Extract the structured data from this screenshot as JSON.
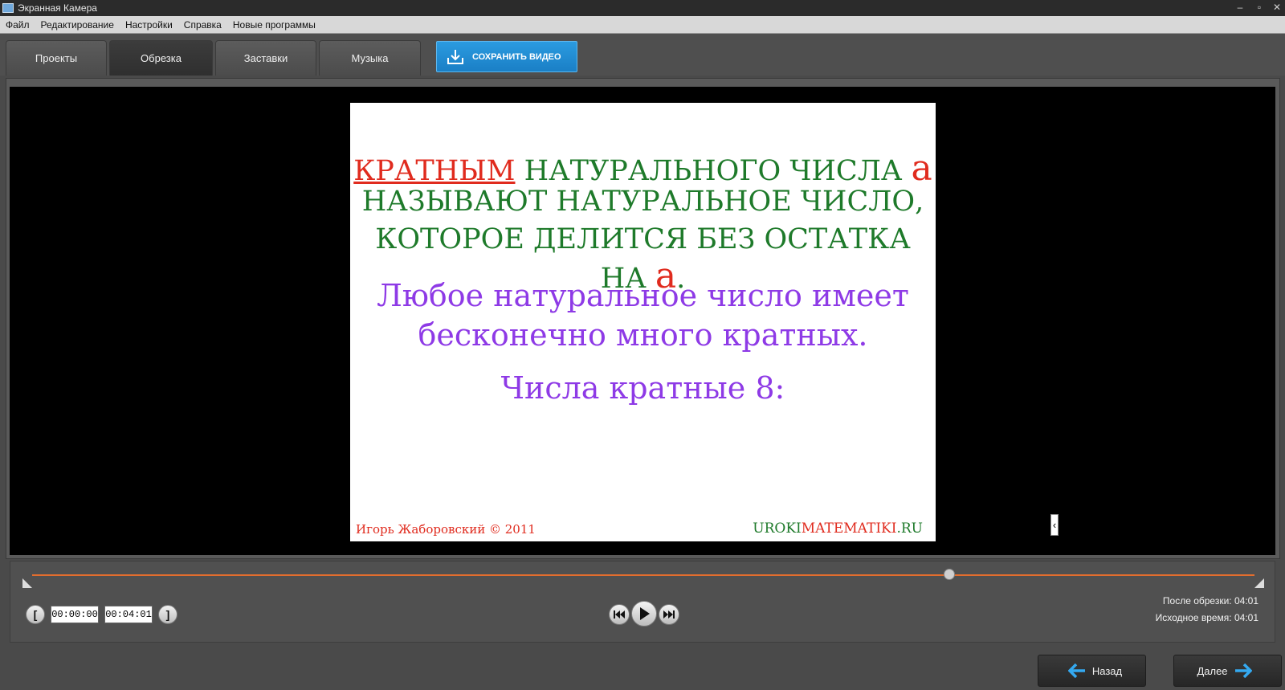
{
  "window": {
    "title": "Экранная Камера",
    "controls": [
      "minimize-icon",
      "restore-icon",
      "close-icon"
    ]
  },
  "menu": [
    "Файл",
    "Редактирование",
    "Настройки",
    "Справка",
    "Новые программы"
  ],
  "tabs": [
    {
      "label": "Проекты",
      "active": false
    },
    {
      "label": "Обрезка",
      "active": true
    },
    {
      "label": "Заставки",
      "active": false
    },
    {
      "label": "Музыка",
      "active": false
    }
  ],
  "save_button": {
    "label": "СОХРАНИТЬ ВИДЕО",
    "icon": "download-icon",
    "color": "#1a8ad6"
  },
  "slide": {
    "line1_a": "КРАТНЫМ",
    "line1_b": " НАТУРАЛЬНОГО ЧИСЛА ",
    "line1_c": "а",
    "line2": "НАЗЫВАЮТ НАТУРАЛЬНОЕ ЧИСЛО,",
    "line3_a": "КОТОРОЕ ДЕЛИТСЯ БЕЗ ОСТАТКА НА ",
    "line3_b": "а",
    "line3_c": ".",
    "purple1": "Любое натуральное число имеет",
    "purple2": "бесконечно много кратных.",
    "purple3": "Числа кратные 8:",
    "author": "Игорь Жаборовский © 2011",
    "site_a": "UROKI",
    "site_b": "MATEMATIKI",
    "site_c": ".RU"
  },
  "timeline": {
    "position_fraction": 0.75,
    "accent_color": "#e36d2e",
    "start_time": "00:00:00",
    "end_time": "00:04:01",
    "start_bracket": "[",
    "end_bracket": "]",
    "after_trim_label": "После обрезки:",
    "after_trim_value": "04:01",
    "original_label": "Исходное время:",
    "original_value": "04:01"
  },
  "nav": {
    "back": "Назад",
    "next": "Далее"
  }
}
